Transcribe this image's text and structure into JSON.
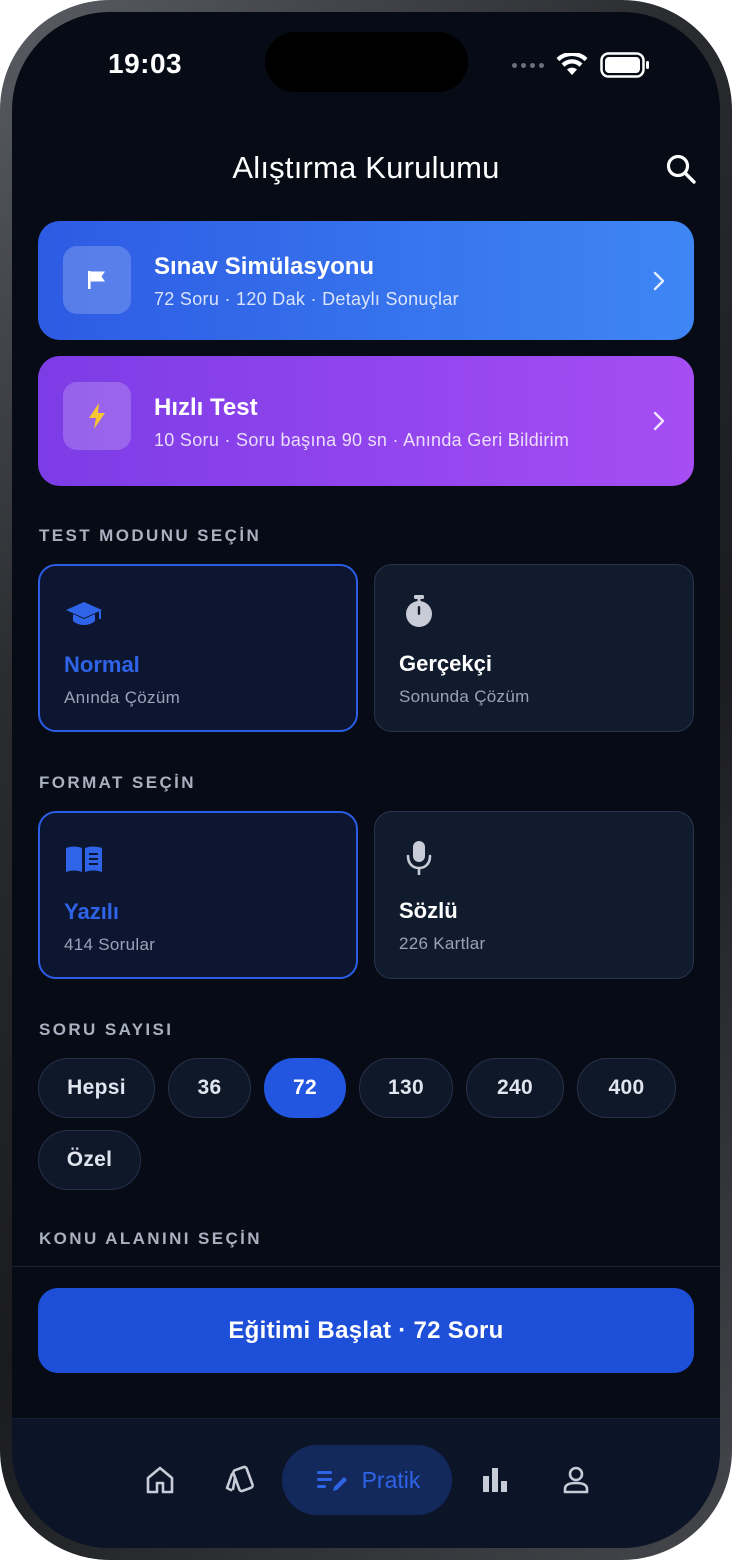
{
  "status_bar": {
    "time": "19:03"
  },
  "header": {
    "title": "Alıştırma Kurulumu",
    "search_icon": "search-icon"
  },
  "promos": {
    "exam": {
      "title": "Sınav Simülasyonu",
      "subtitle": "72 Soru · 120 Dak · Detaylı Sonuçlar",
      "icon": "flag-icon"
    },
    "quick": {
      "title": "Hızlı Test",
      "subtitle": "10 Soru · Soru başına 90 sn · Anında Geri Bildirim",
      "icon": "lightning-icon"
    }
  },
  "test_mode": {
    "label": "TEST MODUNU SEÇİN",
    "options": [
      {
        "title": "Normal",
        "subtitle": "Anında Çözüm",
        "icon": "graduation-cap-icon",
        "selected": true
      },
      {
        "title": "Gerçekçi",
        "subtitle": "Sonunda Çözüm",
        "icon": "stopwatch-icon",
        "selected": false
      }
    ]
  },
  "format": {
    "label": "FORMAT SEÇİN",
    "options": [
      {
        "title": "Yazılı",
        "subtitle": "414 Sorular",
        "icon": "book-icon",
        "selected": true
      },
      {
        "title": "Sözlü",
        "subtitle": "226 Kartlar",
        "icon": "microphone-icon",
        "selected": false
      }
    ]
  },
  "question_count": {
    "label": "SORU SAYISI",
    "chips": [
      "Hepsi",
      "36",
      "72",
      "130",
      "240",
      "400",
      "Özel"
    ],
    "selected": "72"
  },
  "topic": {
    "label": "KONU ALANINI SEÇİN"
  },
  "cta": {
    "label": "Eğitimi Başlat · 72 Soru"
  },
  "tabbar": {
    "tabs": [
      {
        "icon": "home-icon"
      },
      {
        "icon": "cards-icon"
      },
      {
        "icon": "practice-icon",
        "label": "Pratik",
        "active": true
      },
      {
        "icon": "bar-chart-icon"
      },
      {
        "icon": "profile-icon"
      }
    ]
  },
  "colors": {
    "background": "#070b16",
    "accent": "#2256e0",
    "exam_gradient": [
      "#2d5be3",
      "#3f86f5"
    ],
    "quick_gradient": [
      "#7c3ce6",
      "#a64df4"
    ]
  }
}
